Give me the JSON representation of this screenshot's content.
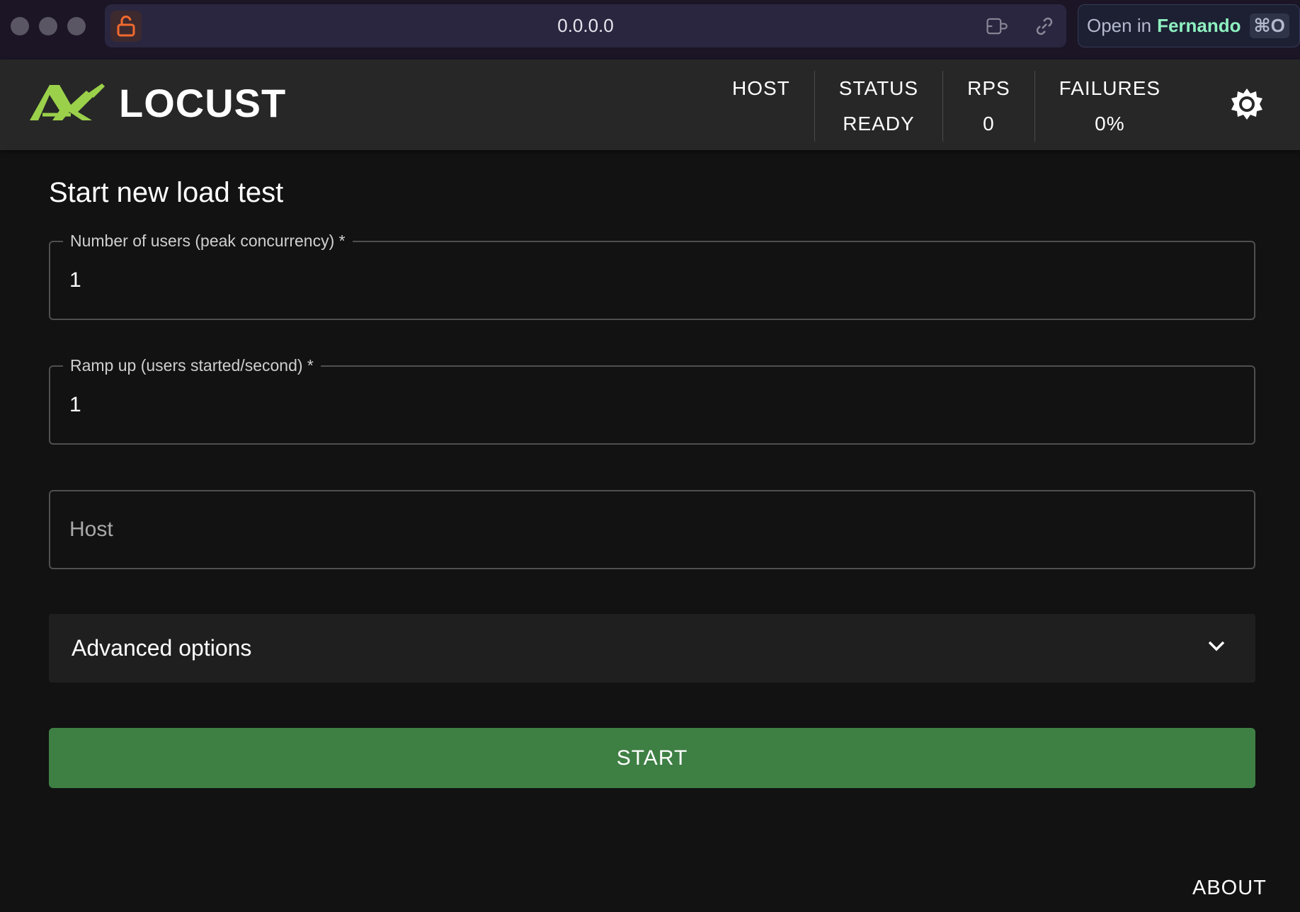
{
  "browser": {
    "url": "0.0.0.0",
    "open_in_prefix": "Open in",
    "open_in_app": "Fernando",
    "open_in_shortcut": "⌘O",
    "icons": [
      "unlock-icon",
      "reader-icon",
      "link-icon"
    ]
  },
  "header": {
    "logo_text": "LOCUST",
    "stats": [
      {
        "label": "HOST",
        "value": ""
      },
      {
        "label": "STATUS",
        "value": "READY"
      },
      {
        "label": "RPS",
        "value": "0"
      },
      {
        "label": "FAILURES",
        "value": "0%"
      }
    ],
    "theme_icon": "brightness-icon"
  },
  "form": {
    "title": "Start new load test",
    "users": {
      "label": "Number of users (peak concurrency) *",
      "value": "1"
    },
    "ramp_up": {
      "label": "Ramp up (users started/second) *",
      "value": "1"
    },
    "host": {
      "placeholder": "Host",
      "value": ""
    },
    "advanced_label": "Advanced options",
    "start_label": "START"
  },
  "footer": {
    "about_label": "ABOUT"
  },
  "colors": {
    "accent_green": "#3e7f44",
    "logo_green": "#9bd14a",
    "background": "#121212",
    "appbar": "#272727"
  }
}
